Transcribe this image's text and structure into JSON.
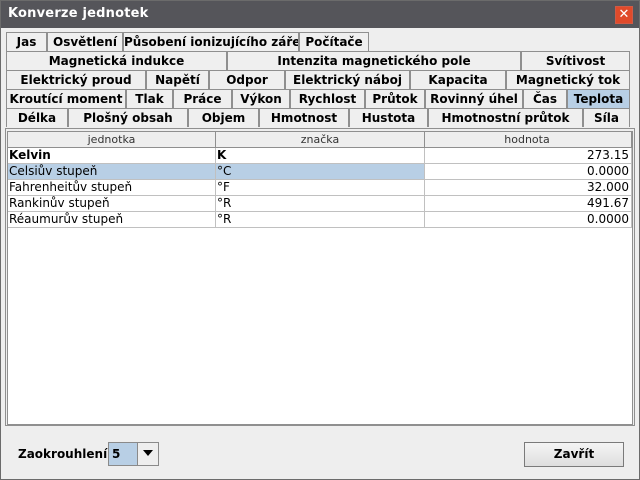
{
  "window": {
    "title": "Konverze jednotek",
    "close_glyph": "✕"
  },
  "tabs": {
    "row1": [
      "Jas",
      "Osvětlení",
      "Působení ionizujícího záření",
      "Počítače"
    ],
    "row2": [
      "Magnetická indukce",
      "Intenzita magnetického pole",
      "Svítivost"
    ],
    "row3": [
      "Elektrický proud",
      "Napětí",
      "Odpor",
      "Elektrický náboj",
      "Kapacita",
      "Magnetický tok"
    ],
    "row4": [
      "Kroutící moment",
      "Tlak",
      "Práce",
      "Výkon",
      "Rychlost",
      "Průtok",
      "Rovinný úhel",
      "Čas",
      "Teplota"
    ],
    "row5": [
      "Délka",
      "Plošný obsah",
      "Objem",
      "Hmotnost",
      "Hustota",
      "Hmotnostní průtok",
      "Síla"
    ],
    "selected": "Teplota"
  },
  "table": {
    "headers": [
      "jednotka",
      "značka",
      "hodnota"
    ],
    "rows": [
      [
        "Kelvin",
        "K",
        "273.15"
      ],
      [
        "Celsiův stupeň",
        "°C",
        "0.0000"
      ],
      [
        "Fahrenheitův stupeň",
        "°F",
        "32.000"
      ],
      [
        "Rankinův stupeň",
        "°R",
        "491.67"
      ],
      [
        "Réaumurův stupeň",
        "°R",
        "0.0000"
      ]
    ]
  },
  "footer": {
    "rounding_label": "Zaokrouhlení:",
    "rounding_value": "5",
    "close_label": "Zavřít"
  },
  "colors": {
    "selection": "#b8cfe5",
    "titlebar": "#55555a"
  },
  "icons": {
    "dropdown": "chevron-down-icon",
    "close": "close-icon"
  }
}
